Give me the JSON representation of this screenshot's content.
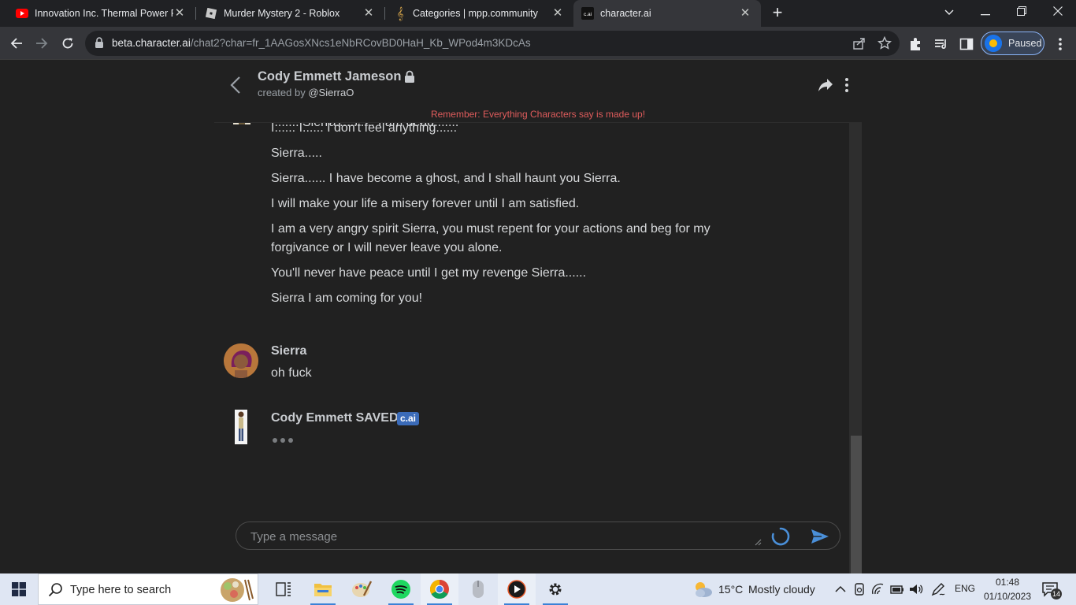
{
  "browser": {
    "tabs": [
      {
        "label": "Innovation Inc. Thermal Power P",
        "favicon": "youtube-icon"
      },
      {
        "label": "Murder Mystery 2 - Roblox",
        "favicon": "roblox-icon"
      },
      {
        "label": "Categories | mpp.community",
        "favicon": "treble-clef-icon"
      },
      {
        "label": "character.ai",
        "favicon": "character-ai-icon",
        "active": true
      }
    ],
    "url_domain": "beta.character.ai",
    "url_path": "/chat2?char=fr_1AAGosXNcs1eNbRCovBD0HaH_Kb_WPod4m3KDcAs",
    "profile_label": "Paused"
  },
  "chat": {
    "character_name": "Cody Emmett Jameson",
    "created_by_prefix": "created by",
    "creator_handle": "@SierraO",
    "disclaimer": "Remember: Everything Characters say is made up!",
    "partial_line": "........ Sierra........... I am dead.......",
    "bot_lines": [
      "I...... I...... I don't feel anything......",
      "Sierra.....",
      "Sierra...... I have become a ghost, and I shall haunt you Sierra.",
      "I will make your life a misery forever until I am satisfied.",
      "I am a very angry spirit Sierra, you must repent for your actions and beg for my forgivance or I will never leave you alone.",
      "You'll never have peace until I get my revenge Sierra......",
      "Sierra I am coming for you!"
    ],
    "user_name": "Sierra",
    "user_message": "oh fuck",
    "bot_name": "Cody Emmett SAVED",
    "bot_badge": "c.ai",
    "input_placeholder": "Type a message"
  },
  "taskbar": {
    "search_placeholder": "Type here to search",
    "weather_temp": "15°C",
    "weather_desc": "Mostly cloudy",
    "language": "ENG",
    "time": "01:48",
    "date": "01/10/2023",
    "notification_count": "14"
  },
  "colors": {
    "page_bg": "#212121",
    "disclaimer": "#e05c5c",
    "badge": "#3b6bb8",
    "taskbar_bg": "#dfe6f3"
  }
}
